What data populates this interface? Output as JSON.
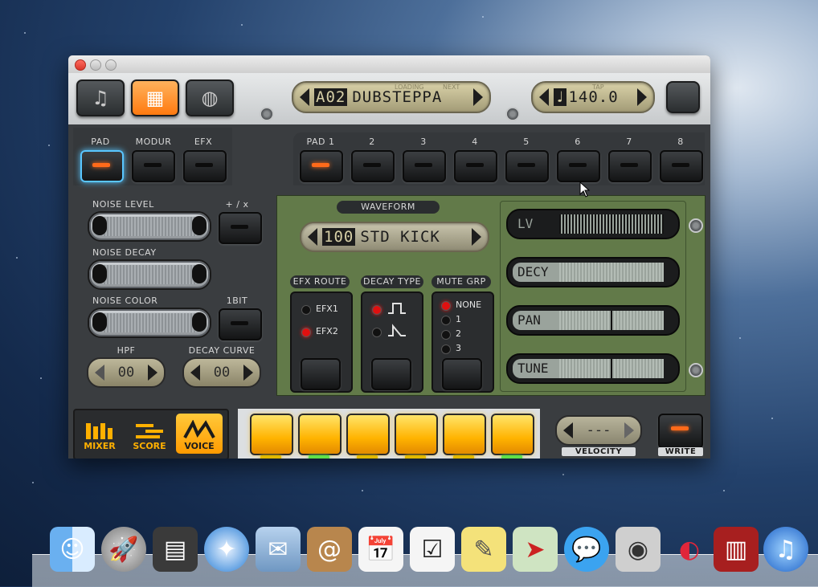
{
  "topbar": {
    "pattern_lcd": {
      "small_loading": "LOADING",
      "small_next": "NEXT",
      "num": "A02",
      "name": "DUBSTEPPA"
    },
    "tempo_lcd": {
      "small_tap": "TAP",
      "note": "♩",
      "value": "140.0"
    }
  },
  "select_tabs": {
    "pad": "PAD",
    "modur": "MODUR",
    "efx": "EFX"
  },
  "pad_tabs": [
    "PAD 1",
    "2",
    "3",
    "4",
    "5",
    "6",
    "7",
    "8"
  ],
  "left_controls": {
    "noise_level": "NOISE LEVEL",
    "plus_x": "+ / x",
    "noise_decay": "NOISE DECAY",
    "noise_color": "NOISE COLOR",
    "onebit": "1BIT",
    "hpf": {
      "label": "HPF",
      "value": "00"
    },
    "decay_curve": {
      "label": "DECAY CURVE",
      "value": "00"
    }
  },
  "waveform": {
    "label": "WAVEFORM",
    "num": "100",
    "name": "STD KICK"
  },
  "efx_route": {
    "label": "EFX ROUTE",
    "options": [
      "EFX1",
      "EFX2"
    ],
    "selected": "EFX2"
  },
  "decay_type": {
    "label": "DECAY TYPE"
  },
  "mute_grp": {
    "label": "MUTE GRP",
    "options": [
      "NONE",
      "1",
      "2",
      "3"
    ],
    "selected": "NONE"
  },
  "params": {
    "lv": "LV",
    "decy": "DECY",
    "pan": "PAN",
    "tune": "TUNE"
  },
  "bottom": {
    "nav": {
      "mixer": "MIXER",
      "score": "SCORE",
      "voice": "VOICE"
    },
    "velocity": {
      "label": "VELOCITY",
      "value": "---"
    },
    "write": "WRITE"
  },
  "colors": {
    "accent": "#ff7a10",
    "lcd": "#d9d1a8",
    "panel_green": "#627a49",
    "pad_yellow": "#ffb300"
  }
}
